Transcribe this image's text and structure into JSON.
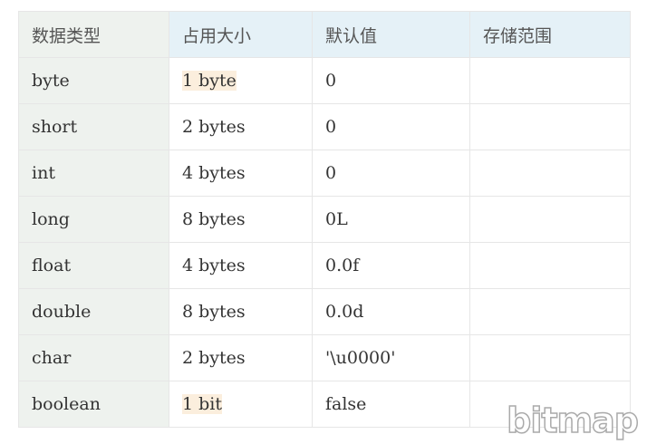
{
  "table": {
    "headers": [
      "数据类型",
      "占用大小",
      "默认值",
      "存储范围"
    ],
    "rows": [
      {
        "type": "byte",
        "size": "1 byte",
        "default": "0",
        "range": "",
        "highlight": true
      },
      {
        "type": "short",
        "size": "2 bytes",
        "default": "0",
        "range": "",
        "highlight": false
      },
      {
        "type": "int",
        "size": "4 bytes",
        "default": "0",
        "range": "",
        "highlight": false
      },
      {
        "type": "long",
        "size": "8 bytes",
        "default": "0L",
        "range": "",
        "highlight": false
      },
      {
        "type": "float",
        "size": "4 bytes",
        "default": "0.0f",
        "range": "",
        "highlight": false
      },
      {
        "type": "double",
        "size": "8 bytes",
        "default": "0.0d",
        "range": "",
        "highlight": false
      },
      {
        "type": "char",
        "size": "2 bytes",
        "default": "'\\u0000'",
        "range": "",
        "highlight": false
      },
      {
        "type": "boolean",
        "size": "1 bit",
        "default": "false",
        "range": "",
        "highlight": true
      }
    ]
  },
  "watermark": "bitmap",
  "colors": {
    "header_bg": "#e5f1f7",
    "first_col_bg": "#eef2ee",
    "highlight": "#fbeedd"
  }
}
